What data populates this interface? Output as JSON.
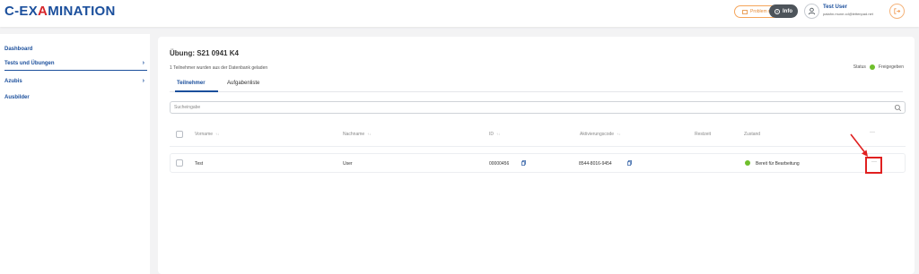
{
  "header": {
    "logo_part1": "C-EX",
    "logo_part2": "A",
    "logo_part3": "MINATION",
    "report_button": "Problem melden",
    "info_button": "Info",
    "user_name": "Test User",
    "user_email": "patahn.mune.cd@lettenpad.net"
  },
  "sidebar": {
    "items": [
      {
        "label": "Dashboard",
        "chevron": ""
      },
      {
        "label": "Tests und Übungen",
        "chevron": "›"
      },
      {
        "label": "Azubis",
        "chevron": "›"
      },
      {
        "label": "Ausbilder",
        "chevron": ""
      }
    ]
  },
  "main": {
    "title": "Übung: S21 0941 K4",
    "loaded_text": "1 Teilnehmer wurden aus der Datenbank geladen",
    "status_label": "Status",
    "status_value": "Freigegeben",
    "tabs": [
      {
        "label": "Teilnehmer"
      },
      {
        "label": "Aufgabenliste"
      }
    ],
    "search_placeholder": "Sucheingabe",
    "columns": {
      "vorname": "Vorname",
      "nachname": "Nachname",
      "id": "ID",
      "code": "Aktivierungscode",
      "restzeit": "Restzeit",
      "zustand": "Zustand",
      "more": "···",
      "sort_symbol": "↑↓"
    },
    "rows": [
      {
        "vorname": "Test",
        "nachname": "User",
        "id": "00000456",
        "code": "8544-8016-9454",
        "restzeit": "",
        "zustand": "Bereit für Bearbeitung",
        "more": "···"
      }
    ]
  },
  "colors": {
    "brand_blue": "#1b4f9c",
    "brand_red": "#d7262b",
    "status_green": "#6fbf2c",
    "annotation_red": "#e02020"
  }
}
